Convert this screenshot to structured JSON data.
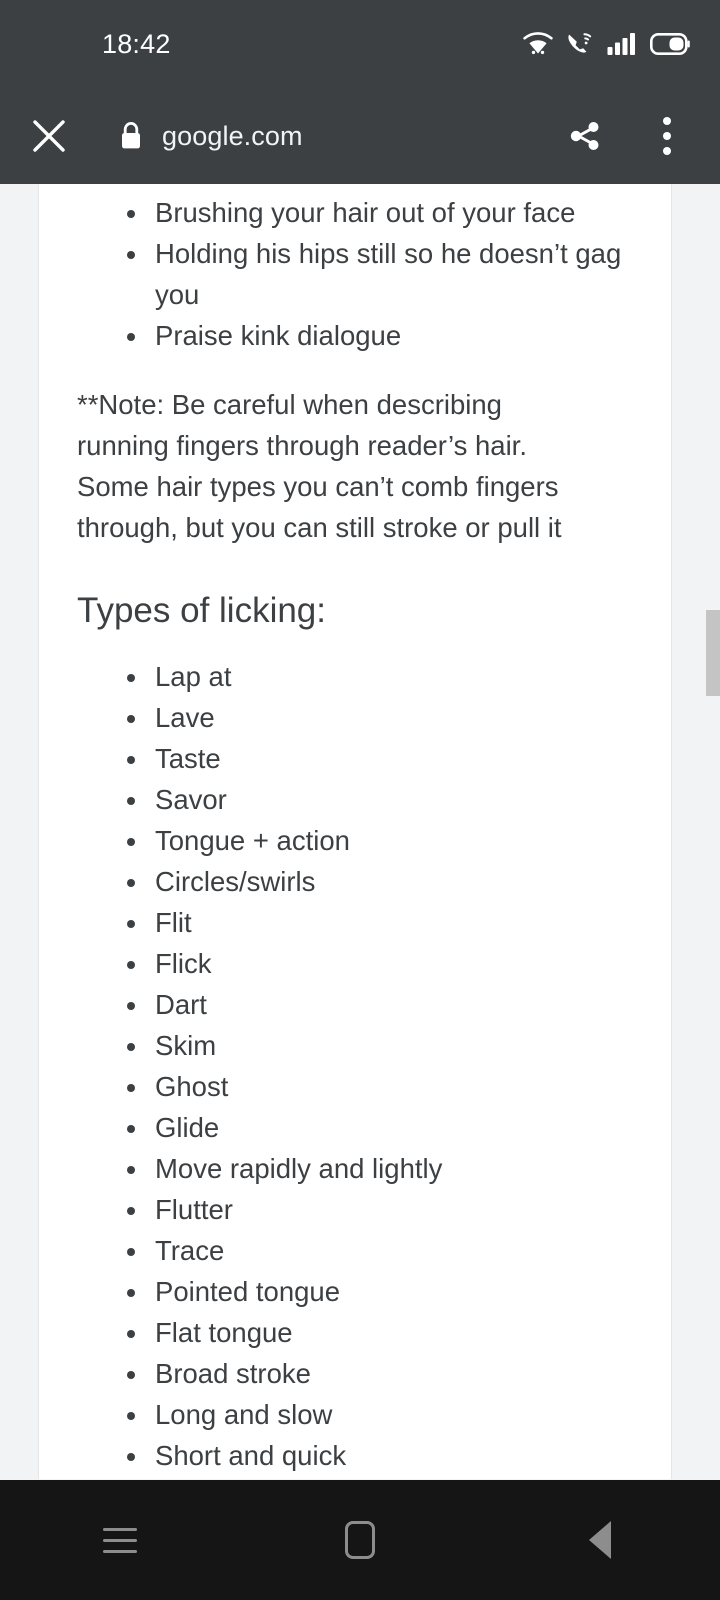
{
  "status_bar": {
    "time": "18:42",
    "icons": [
      "wifi-icon",
      "wifi-calling-icon",
      "cellular-signal-icon",
      "battery-icon"
    ],
    "background": "#3c4043",
    "foreground": "#ffffff"
  },
  "toolbar": {
    "close_icon": "close-icon",
    "lock_icon": "lock-icon",
    "url": "google.com",
    "share_icon": "share-icon",
    "menu_icon": "overflow-menu-icon",
    "background": "#3c4043"
  },
  "page": {
    "text_color": "#3c4043",
    "background": "#ffffff",
    "blocks": [
      {
        "type": "list",
        "items": [
          "Brushing your hair out of your face",
          "Holding his hips still so he doesn’t gag you",
          "Praise kink dialogue"
        ]
      },
      {
        "type": "paragraph",
        "text": "**Note: Be careful when describing running fingers through reader’s hair. Some hair types you can’t comb fingers through, but you can still stroke or pull it"
      },
      {
        "type": "heading",
        "text": "Types of licking:"
      },
      {
        "type": "list",
        "items": [
          "Lap at",
          "Lave",
          "Taste",
          "Savor",
          "Tongue + action",
          "Circles/swirls",
          "Flit",
          "Flick",
          "Dart",
          "Skim",
          "Ghost",
          "Glide",
          "Move rapidly and lightly",
          "Flutter",
          "Trace",
          "Pointed tongue",
          "Flat tongue",
          "Broad stroke",
          "Long and slow",
          "Short and quick"
        ]
      }
    ]
  },
  "scrollbar": {
    "thumb_color": "#c4c4c4"
  },
  "nav_bar": {
    "background": "#151515",
    "buttons": [
      {
        "name": "recents-button",
        "icon": "recents-icon"
      },
      {
        "name": "home-button",
        "icon": "home-icon"
      },
      {
        "name": "back-button",
        "icon": "back-icon"
      }
    ]
  }
}
